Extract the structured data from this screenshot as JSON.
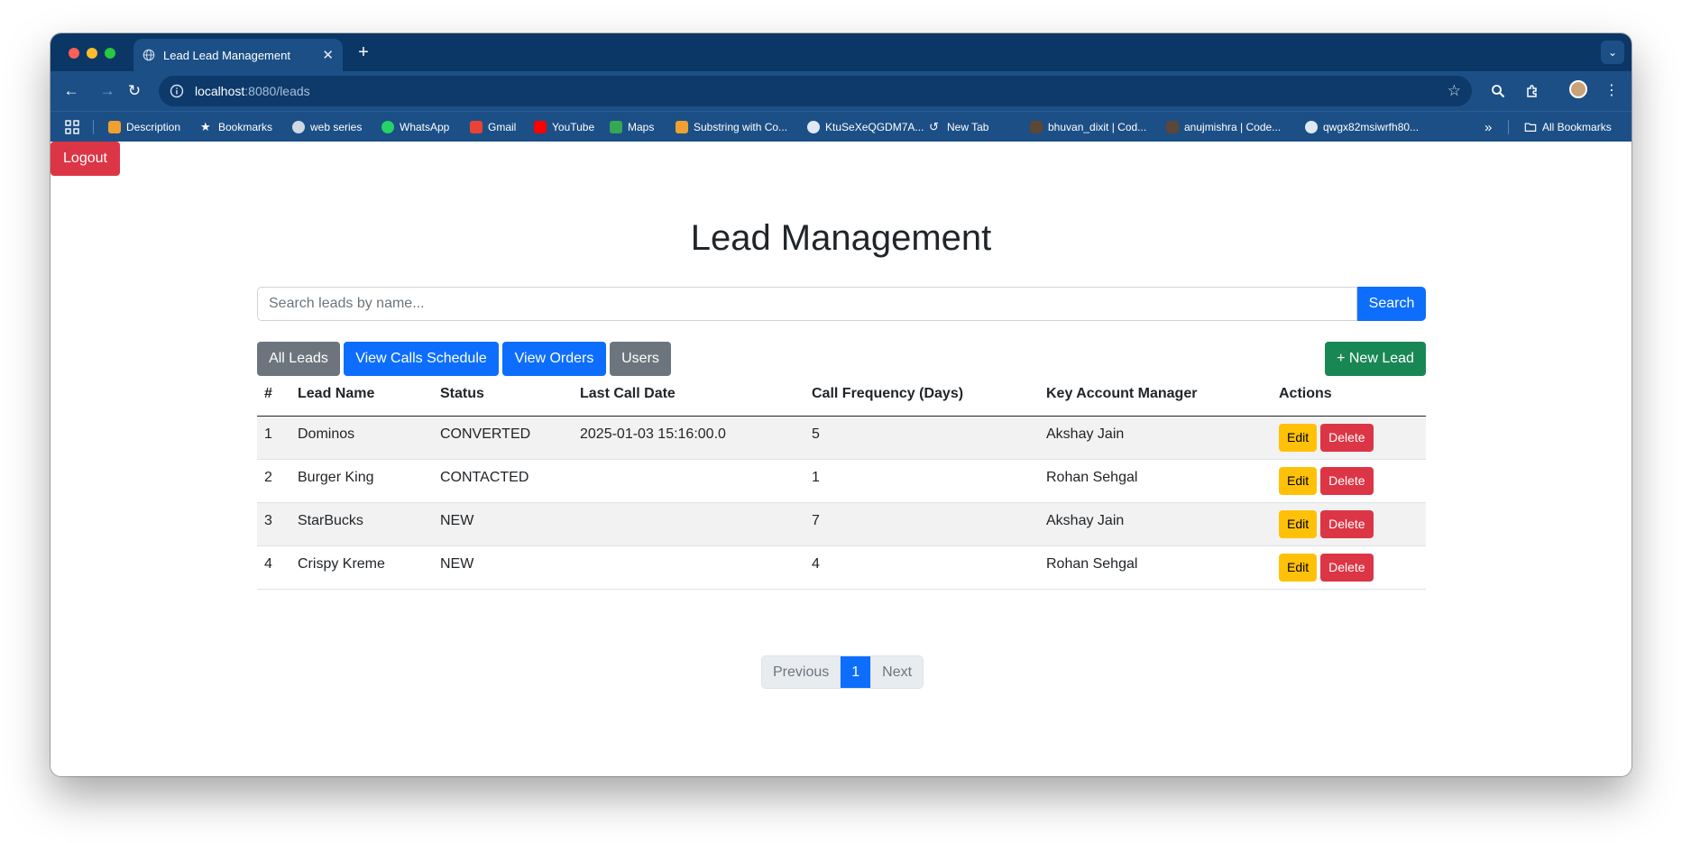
{
  "browser": {
    "tab_title": "Lead Lead Management",
    "tab_close": "✕",
    "new_tab": "+",
    "url_host": "localhost",
    "url_path": ":8080/leads",
    "bookmarks": [
      {
        "label": "Description",
        "icon": "leetcode-icon"
      },
      {
        "label": "Bookmarks",
        "icon": "star-icon"
      },
      {
        "label": "web series",
        "icon": "film-reel-icon"
      },
      {
        "label": "WhatsApp",
        "icon": "whatsapp-icon"
      },
      {
        "label": "Gmail",
        "icon": "gmail-icon"
      },
      {
        "label": "YouTube",
        "icon": "youtube-icon"
      },
      {
        "label": "Maps",
        "icon": "maps-icon"
      },
      {
        "label": "Substring with Co...",
        "icon": "leetcode-icon"
      },
      {
        "label": "KtuSeXeQGDM7A...",
        "icon": "globe-icon"
      },
      {
        "label": "New Tab",
        "icon": "history-icon"
      },
      {
        "label": "bhuvan_dixit | Cod...",
        "icon": "codechef-icon"
      },
      {
        "label": "anujmishra | Code...",
        "icon": "codechef-icon"
      },
      {
        "label": "qwgx82msiwrfh80...",
        "icon": "globe-icon"
      }
    ],
    "more_bookmarks": "»",
    "all_bookmarks": "All Bookmarks"
  },
  "page": {
    "logout_label": "Logout",
    "title": "Lead Management",
    "search": {
      "placeholder": "Search leads by name...",
      "button_label": "Search"
    },
    "nav_buttons": [
      {
        "label": "All Leads",
        "style": "secondary"
      },
      {
        "label": "View Calls Schedule",
        "style": "primary"
      },
      {
        "label": "View Orders",
        "style": "primary"
      },
      {
        "label": "Users",
        "style": "secondary"
      }
    ],
    "new_lead_label": "+ New Lead",
    "table": {
      "headers": [
        "#",
        "Lead Name",
        "Status",
        "Last Call Date",
        "Call Frequency (Days)",
        "Key Account Manager",
        "Actions"
      ],
      "rows": [
        {
          "id": "1",
          "name": "Dominos",
          "status": "CONVERTED",
          "last_call": "2025-01-03 15:16:00.0",
          "frequency": "5",
          "manager": "Akshay Jain"
        },
        {
          "id": "2",
          "name": "Burger King",
          "status": "CONTACTED",
          "last_call": "",
          "frequency": "1",
          "manager": "Rohan Sehgal"
        },
        {
          "id": "3",
          "name": "StarBucks",
          "status": "NEW",
          "last_call": "",
          "frequency": "7",
          "manager": "Akshay Jain"
        },
        {
          "id": "4",
          "name": "Crispy Kreme",
          "status": "NEW",
          "last_call": "",
          "frequency": "4",
          "manager": "Rohan Sehgal"
        }
      ],
      "edit_label": "Edit",
      "delete_label": "Delete"
    },
    "pagination": {
      "previous": "Previous",
      "current": "1",
      "next": "Next"
    }
  },
  "colors": {
    "tabstrip": "#0b3767",
    "toolbar": "#1c4f86",
    "danger": "#dc3545",
    "primary": "#0d6efd",
    "secondary": "#6c757d",
    "success": "#198754",
    "warning": "#ffc107"
  }
}
